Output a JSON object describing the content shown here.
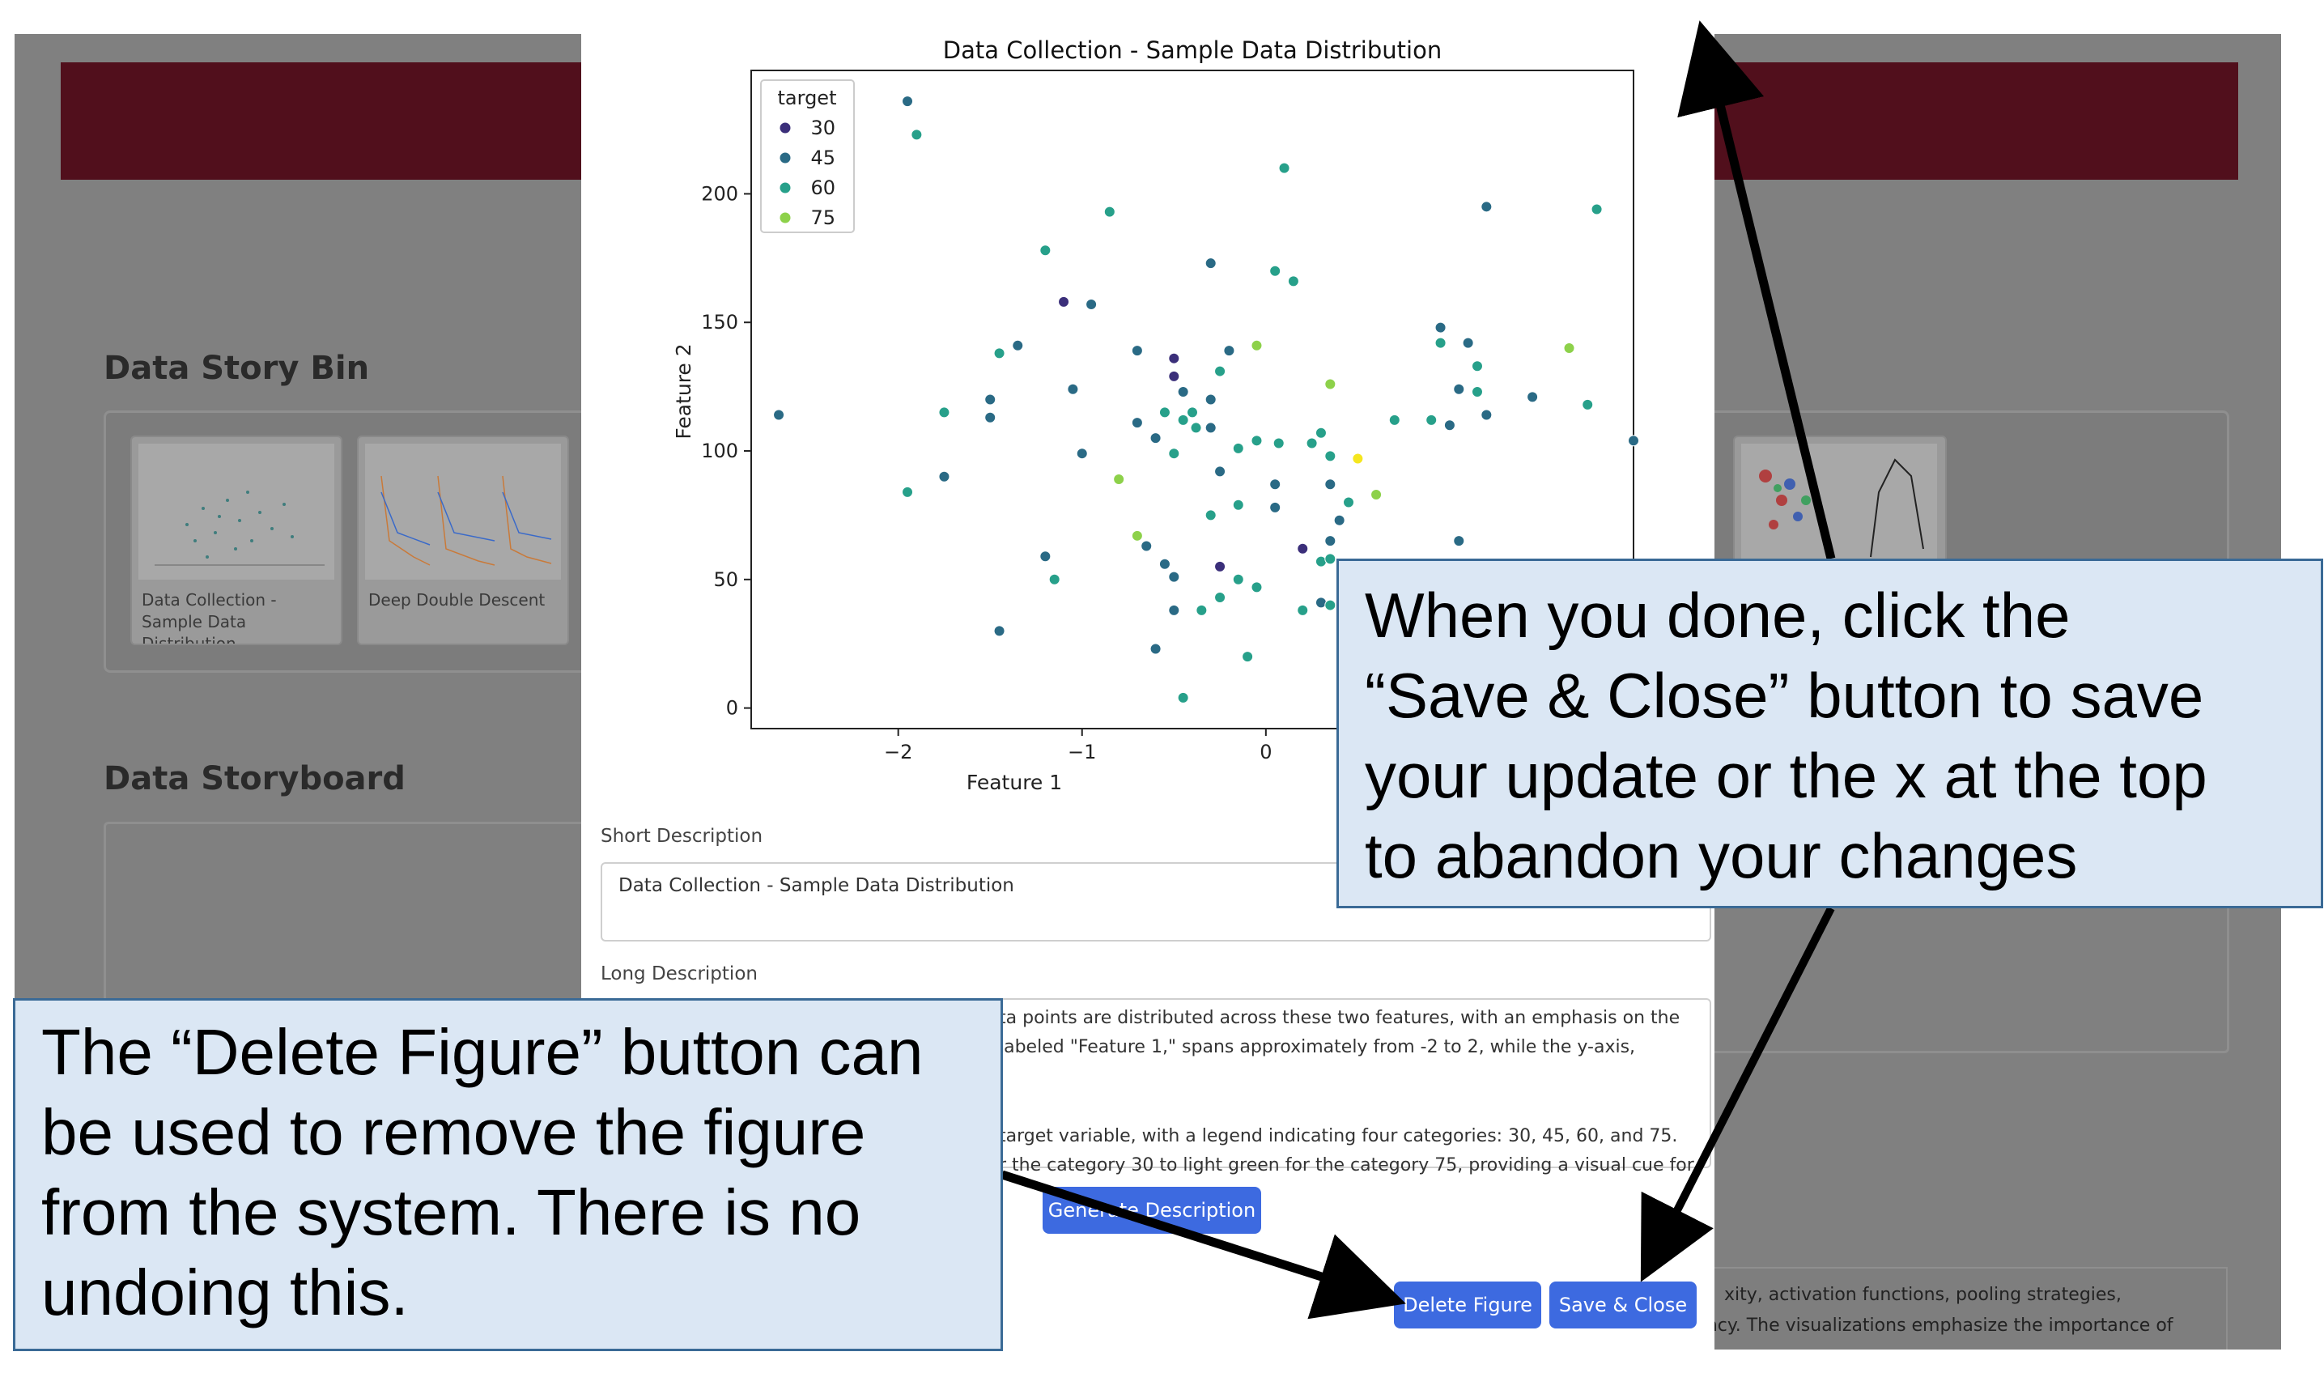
{
  "background": {
    "data_story_bin_title": "Data Story Bin",
    "data_storyboard_title": "Data Storyboard",
    "thumbnails": [
      {
        "label": "Data Collection - Sample Data Distribution"
      },
      {
        "label": "Deep Double Descent"
      }
    ],
    "bottom_text_right": "xity, activation functions, pooling strategies,",
    "bottom_text_line2": "and transformations impact model accuracy, robustness, and learning efficiency. The visualizations emphasize the importance of"
  },
  "modal": {
    "short_description_label": "Short Description",
    "short_description_value": "Data Collection - Sample Data Distribution",
    "long_description_label": "Long Description",
    "long_description_lines": [
      "ta points are distributed across these two features, with an emphasis on the",
      "labeled \"Feature 1,\" spans approximately from -2 to 2, while the y-axis,",
      "",
      "",
      "target variable, with a legend indicating four categories: 30, 45, 60, and 75.",
      "r the category 30 to light green for the category 75, providing a visual cue for"
    ],
    "generate_button": "Generate Description",
    "delete_button": "Delete Figure",
    "save_close_button": "Save & Close"
  },
  "callouts": {
    "save_close_note": [
      "When you done, click the",
      "“Save & Close” button to save",
      "your update or the x at the top",
      "to abandon your changes"
    ],
    "delete_note": [
      "The “Delete Figure” button can",
      "be used to remove the figure",
      "from the system. There is no",
      "undoing this."
    ]
  },
  "colors": {
    "header": "#510f1c",
    "button": "#3d6ae0",
    "callout_bg": "#dbe7f4",
    "cat30": "#3b2f7a",
    "cat45": "#2a6a85",
    "cat60": "#27a08a",
    "cat75": "#8dd14a",
    "cat90": "#f5e61f"
  },
  "chart_data": {
    "type": "scatter",
    "title": "Data Collection - Sample Data Distribution",
    "xlabel": "Feature 1",
    "ylabel": "Feature 2",
    "xlim": [
      -2.8,
      2.0
    ],
    "ylim": [
      -8,
      248
    ],
    "xticks": [
      -2,
      -1,
      0
    ],
    "yticks": [
      0,
      50,
      100,
      150,
      200
    ],
    "legend": {
      "title": "target",
      "entries": [
        "30",
        "45",
        "60",
        "75"
      ],
      "position": "top-left"
    },
    "points": [
      {
        "x": -1.95,
        "y": 236,
        "c": 45
      },
      {
        "x": -1.9,
        "y": 223,
        "c": 60
      },
      {
        "x": -0.85,
        "y": 193,
        "c": 60
      },
      {
        "x": 0.1,
        "y": 210,
        "c": 60
      },
      {
        "x": -1.2,
        "y": 178,
        "c": 60
      },
      {
        "x": -0.3,
        "y": 173,
        "c": 45
      },
      {
        "x": 0.05,
        "y": 170,
        "c": 60
      },
      {
        "x": 0.15,
        "y": 166,
        "c": 60
      },
      {
        "x": -1.1,
        "y": 158,
        "c": 30
      },
      {
        "x": -0.95,
        "y": 157,
        "c": 45
      },
      {
        "x": -1.35,
        "y": 141,
        "c": 45
      },
      {
        "x": -1.45,
        "y": 138,
        "c": 60
      },
      {
        "x": -0.7,
        "y": 139,
        "c": 45
      },
      {
        "x": -0.2,
        "y": 139,
        "c": 45
      },
      {
        "x": -0.05,
        "y": 141,
        "c": 75
      },
      {
        "x": -0.5,
        "y": 136,
        "c": 30
      },
      {
        "x": -0.25,
        "y": 131,
        "c": 60
      },
      {
        "x": -0.5,
        "y": 129,
        "c": 30
      },
      {
        "x": -1.05,
        "y": 124,
        "c": 45
      },
      {
        "x": -0.3,
        "y": 120,
        "c": 45
      },
      {
        "x": -0.45,
        "y": 123,
        "c": 45
      },
      {
        "x": -0.55,
        "y": 115,
        "c": 60
      },
      {
        "x": -1.5,
        "y": 120,
        "c": 45
      },
      {
        "x": -1.75,
        "y": 115,
        "c": 60
      },
      {
        "x": -1.5,
        "y": 113,
        "c": 45
      },
      {
        "x": -2.65,
        "y": 114,
        "c": 45
      },
      {
        "x": -0.4,
        "y": 115,
        "c": 60
      },
      {
        "x": -0.7,
        "y": 111,
        "c": 45
      },
      {
        "x": -0.45,
        "y": 112,
        "c": 60
      },
      {
        "x": -0.38,
        "y": 109,
        "c": 60
      },
      {
        "x": -0.3,
        "y": 109,
        "c": 45
      },
      {
        "x": -0.6,
        "y": 105,
        "c": 45
      },
      {
        "x": -0.15,
        "y": 101,
        "c": 60
      },
      {
        "x": -0.05,
        "y": 104,
        "c": 60
      },
      {
        "x": 0.07,
        "y": 103,
        "c": 60
      },
      {
        "x": -0.5,
        "y": 99,
        "c": 60
      },
      {
        "x": -1.0,
        "y": 99,
        "c": 45
      },
      {
        "x": -1.75,
        "y": 90,
        "c": 45
      },
      {
        "x": -1.95,
        "y": 84,
        "c": 60
      },
      {
        "x": -0.8,
        "y": 89,
        "c": 75
      },
      {
        "x": -0.25,
        "y": 92,
        "c": 45
      },
      {
        "x": 0.05,
        "y": 87,
        "c": 45
      },
      {
        "x": -0.15,
        "y": 79,
        "c": 60
      },
      {
        "x": 0.05,
        "y": 78,
        "c": 45
      },
      {
        "x": -0.3,
        "y": 75,
        "c": 60
      },
      {
        "x": 0.3,
        "y": 107,
        "c": 60
      },
      {
        "x": 0.35,
        "y": 126,
        "c": 75
      },
      {
        "x": 0.25,
        "y": 103,
        "c": 60
      },
      {
        "x": 0.35,
        "y": 98,
        "c": 60
      },
      {
        "x": 0.35,
        "y": 87,
        "c": 45
      },
      {
        "x": 0.45,
        "y": 80,
        "c": 60
      },
      {
        "x": 0.35,
        "y": 65,
        "c": 45
      },
      {
        "x": 0.5,
        "y": 97,
        "c": 90
      },
      {
        "x": 0.6,
        "y": 83,
        "c": 75
      },
      {
        "x": 0.4,
        "y": 73,
        "c": 45
      },
      {
        "x": 0.2,
        "y": 62,
        "c": 30
      },
      {
        "x": -0.7,
        "y": 67,
        "c": 75
      },
      {
        "x": -0.65,
        "y": 63,
        "c": 45
      },
      {
        "x": -0.55,
        "y": 56,
        "c": 45
      },
      {
        "x": -0.5,
        "y": 51,
        "c": 45
      },
      {
        "x": -0.25,
        "y": 55,
        "c": 30
      },
      {
        "x": -0.15,
        "y": 50,
        "c": 60
      },
      {
        "x": 0.3,
        "y": 57,
        "c": 60
      },
      {
        "x": 0.35,
        "y": 58,
        "c": 60
      },
      {
        "x": -0.05,
        "y": 47,
        "c": 60
      },
      {
        "x": -1.2,
        "y": 59,
        "c": 45
      },
      {
        "x": -1.15,
        "y": 50,
        "c": 60
      },
      {
        "x": -0.25,
        "y": 43,
        "c": 60
      },
      {
        "x": -0.5,
        "y": 38,
        "c": 45
      },
      {
        "x": -0.35,
        "y": 38,
        "c": 60
      },
      {
        "x": 0.2,
        "y": 38,
        "c": 60
      },
      {
        "x": 0.3,
        "y": 41,
        "c": 45
      },
      {
        "x": 0.35,
        "y": 40,
        "c": 60
      },
      {
        "x": -1.45,
        "y": 30,
        "c": 45
      },
      {
        "x": -0.6,
        "y": 23,
        "c": 45
      },
      {
        "x": -0.1,
        "y": 20,
        "c": 60
      },
      {
        "x": -0.45,
        "y": 4,
        "c": 60
      },
      {
        "x": 0.95,
        "y": 148,
        "c": 45
      },
      {
        "x": 0.95,
        "y": 142,
        "c": 60
      },
      {
        "x": 1.1,
        "y": 142,
        "c": 45
      },
      {
        "x": 1.15,
        "y": 133,
        "c": 60
      },
      {
        "x": 1.15,
        "y": 123,
        "c": 60
      },
      {
        "x": 1.05,
        "y": 124,
        "c": 45
      },
      {
        "x": 1.2,
        "y": 114,
        "c": 45
      },
      {
        "x": 0.9,
        "y": 112,
        "c": 60
      },
      {
        "x": 0.7,
        "y": 112,
        "c": 60
      },
      {
        "x": 1.0,
        "y": 110,
        "c": 45
      },
      {
        "x": 1.45,
        "y": 121,
        "c": 45
      },
      {
        "x": 1.65,
        "y": 140,
        "c": 75
      },
      {
        "x": 1.75,
        "y": 118,
        "c": 60
      },
      {
        "x": 2.0,
        "y": 104,
        "c": 45
      },
      {
        "x": 1.2,
        "y": 195,
        "c": 45
      },
      {
        "x": 1.8,
        "y": 194,
        "c": 60
      },
      {
        "x": 1.05,
        "y": 65,
        "c": 45
      }
    ]
  }
}
